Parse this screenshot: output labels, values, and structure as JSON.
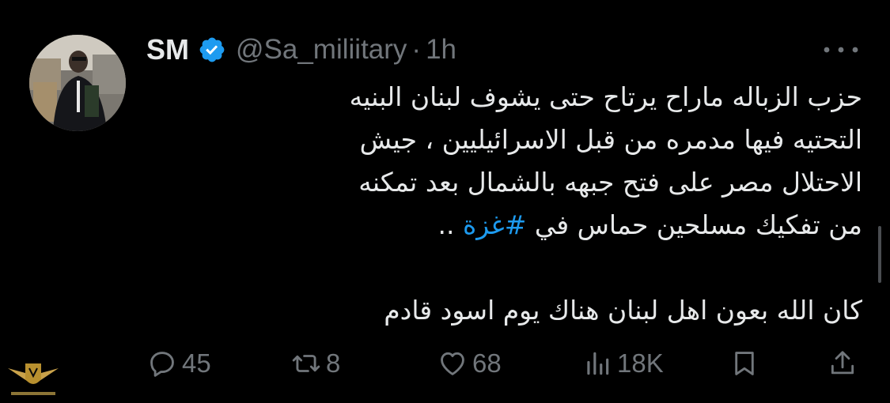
{
  "tweet": {
    "display_name": "SM",
    "handle": "@Sa_miliitary",
    "separator": "·",
    "time": "1h",
    "text_lines": [
      "حزب الزباله ماراح يرتاح حتى يشوف لبنان البنيه",
      "التحتيه فيها مدمره من قبل الاسرائيليين ، جيش",
      "الاحتلال مصر على فتح جبهه بالشمال بعد تمكنه",
      "من تفكيك مسلحين حماس في"
    ],
    "hashtag": "#غزة",
    "line4_tail": " ..",
    "paragraph2": "كان الله بعون اهل لبنان هناك يوم اسود قادم"
  },
  "actions": {
    "replies": "45",
    "reposts": "8",
    "likes": "68",
    "views": "18K"
  },
  "colors": {
    "background": "#000000",
    "text": "#e7e9ea",
    "secondary": "#71767b",
    "accent": "#1d9bf0"
  },
  "icons": {
    "verified": "verified-badge-icon",
    "more": "more-horizontal-icon",
    "reply": "reply-icon",
    "repost": "repost-icon",
    "like": "heart-icon",
    "views": "views-chart-icon",
    "bookmark": "bookmark-icon",
    "share": "share-icon"
  }
}
